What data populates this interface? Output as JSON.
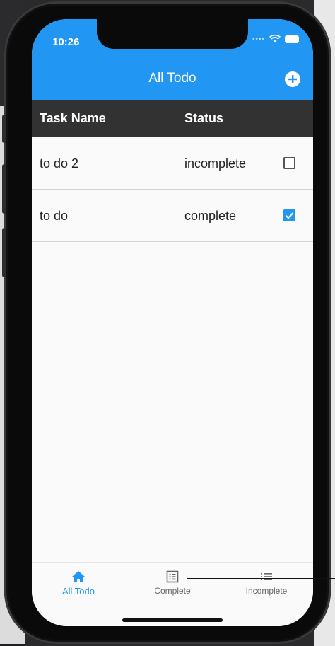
{
  "status_bar": {
    "time": "10:26"
  },
  "app_bar": {
    "title": "All Todo"
  },
  "table": {
    "headers": [
      "Task Name",
      "Status"
    ],
    "rows": [
      {
        "name": "to do 2",
        "status": "incomplete",
        "checked": false
      },
      {
        "name": "to do",
        "status": "complete",
        "checked": true
      }
    ]
  },
  "bottom_nav": {
    "items": [
      {
        "label": "All Todo",
        "icon": "home-icon",
        "active": true
      },
      {
        "label": "Complete",
        "icon": "list-box-icon",
        "active": false
      },
      {
        "label": "Incomplete",
        "icon": "list-icon",
        "active": false
      }
    ]
  },
  "colors": {
    "accent": "#2196f3",
    "header_bg": "#323232",
    "screen_bg": "#fafafa"
  }
}
